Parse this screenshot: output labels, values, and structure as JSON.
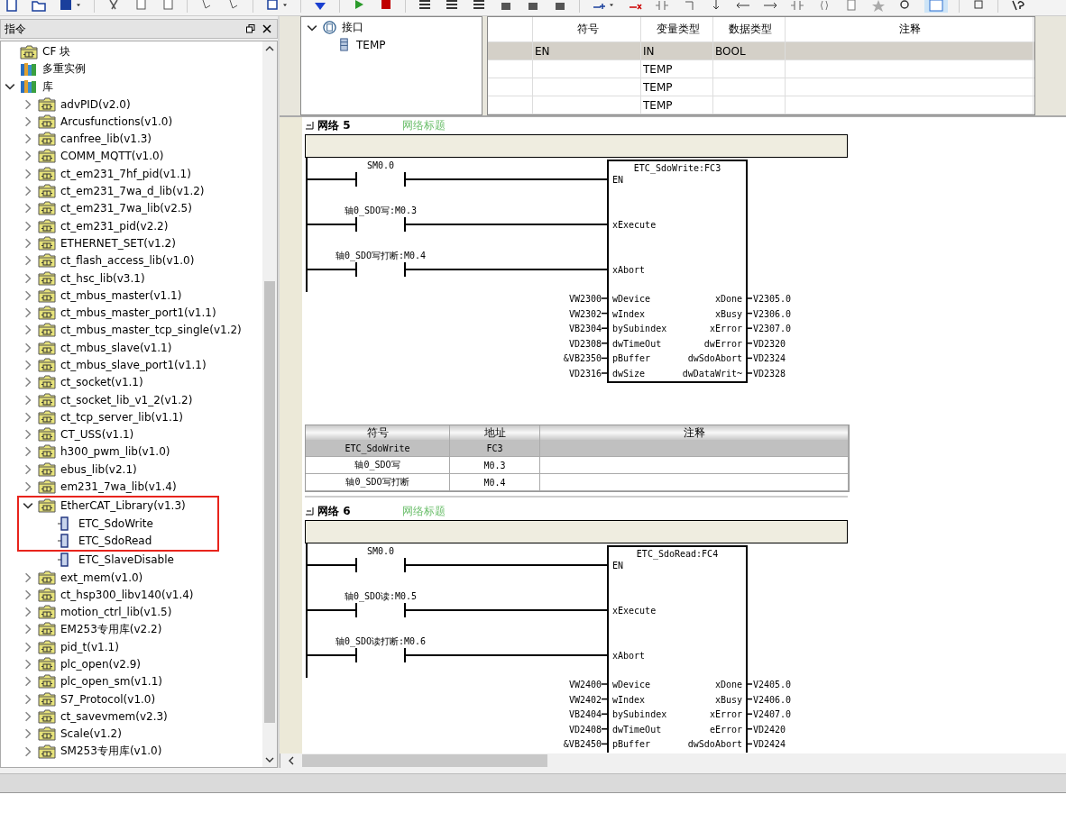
{
  "instructions": {
    "title": "指令",
    "tree": [
      {
        "label": "CF 块",
        "kind": "block-folder",
        "highlighted": false
      },
      {
        "label": "多重实例",
        "kind": "books",
        "highlighted": false
      },
      {
        "label": "库",
        "kind": "books",
        "expanded": true,
        "highlighted": false,
        "children": [
          {
            "label": "advPID(v2.0)",
            "kind": "block-folder",
            "expanded": false,
            "highlighted": false
          },
          {
            "label": "Arcusfunctions(v1.0)",
            "kind": "block-folder",
            "expanded": false,
            "highlighted": false
          },
          {
            "label": "canfree_lib(v1.3)",
            "kind": "block-folder",
            "expanded": false,
            "highlighted": false
          },
          {
            "label": "COMM_MQTT(v1.0)",
            "kind": "block-folder",
            "expanded": false,
            "highlighted": false
          },
          {
            "label": "ct_em231_7hf_pid(v1.1)",
            "kind": "block-folder",
            "expanded": false,
            "highlighted": false
          },
          {
            "label": "ct_em231_7wa_d_lib(v1.2)",
            "kind": "block-folder",
            "expanded": false,
            "highlighted": false
          },
          {
            "label": "ct_em231_7wa_lib(v2.5)",
            "kind": "block-folder",
            "expanded": false,
            "highlighted": false
          },
          {
            "label": "ct_em231_pid(v2.2)",
            "kind": "block-folder",
            "expanded": false,
            "highlighted": false
          },
          {
            "label": "ETHERNET_SET(v1.2)",
            "kind": "block-folder",
            "expanded": false,
            "highlighted": false
          },
          {
            "label": "ct_flash_access_lib(v1.0)",
            "kind": "block-folder",
            "expanded": false,
            "highlighted": false
          },
          {
            "label": "ct_hsc_lib(v3.1)",
            "kind": "block-folder",
            "expanded": false,
            "highlighted": false
          },
          {
            "label": "ct_mbus_master(v1.1)",
            "kind": "block-folder",
            "expanded": false,
            "highlighted": false
          },
          {
            "label": "ct_mbus_master_port1(v1.1)",
            "kind": "block-folder",
            "expanded": false,
            "highlighted": false
          },
          {
            "label": "ct_mbus_master_tcp_single(v1.2)",
            "kind": "block-folder",
            "expanded": false,
            "highlighted": false
          },
          {
            "label": "ct_mbus_slave(v1.1)",
            "kind": "block-folder",
            "expanded": false,
            "highlighted": false
          },
          {
            "label": "ct_mbus_slave_port1(v1.1)",
            "kind": "block-folder",
            "expanded": false,
            "highlighted": false
          },
          {
            "label": "ct_socket(v1.1)",
            "kind": "block-folder",
            "expanded": false,
            "highlighted": false
          },
          {
            "label": "ct_socket_lib_v1_2(v1.2)",
            "kind": "block-folder",
            "expanded": false,
            "highlighted": false
          },
          {
            "label": "ct_tcp_server_lib(v1.1)",
            "kind": "block-folder",
            "expanded": false,
            "highlighted": false
          },
          {
            "label": "CT_USS(v1.1)",
            "kind": "block-folder",
            "expanded": false,
            "highlighted": false
          },
          {
            "label": "h300_pwm_lib(v1.0)",
            "kind": "block-folder",
            "expanded": false,
            "highlighted": false
          },
          {
            "label": "ebus_lib(v2.1)",
            "kind": "block-folder",
            "expanded": false,
            "highlighted": false
          },
          {
            "label": "em231_7wa_lib(v1.4)",
            "kind": "block-folder",
            "expanded": false,
            "highlighted": false
          },
          {
            "label": "EtherCAT_Library(v1.3)",
            "kind": "block-folder",
            "expanded": true,
            "highlighted": true,
            "children": [
              {
                "label": "ETC_SdoWrite",
                "kind": "function",
                "highlighted": true
              },
              {
                "label": "ETC_SdoRead",
                "kind": "function",
                "highlighted": true
              },
              {
                "label": "ETC_SlaveDisable",
                "kind": "function",
                "highlighted": false
              }
            ]
          },
          {
            "label": "ext_mem(v1.0)",
            "kind": "block-folder",
            "expanded": false,
            "highlighted": false
          },
          {
            "label": "ct_hsp300_libv140(v1.4)",
            "kind": "block-folder",
            "expanded": false,
            "highlighted": false
          },
          {
            "label": "motion_ctrl_lib(v1.5)",
            "kind": "block-folder",
            "expanded": false,
            "highlighted": false
          },
          {
            "label": "EM253专用库(v2.2)",
            "kind": "block-folder",
            "expanded": false,
            "highlighted": false
          },
          {
            "label": "pid_t(v1.1)",
            "kind": "block-folder",
            "expanded": false,
            "highlighted": false
          },
          {
            "label": "plc_open(v2.9)",
            "kind": "block-folder",
            "expanded": false,
            "highlighted": false
          },
          {
            "label": "plc_open_sm(v1.1)",
            "kind": "block-folder",
            "expanded": false,
            "highlighted": false
          },
          {
            "label": "S7_Protocol(v1.0)",
            "kind": "block-folder",
            "expanded": false,
            "highlighted": false
          },
          {
            "label": "ct_savevmem(v2.3)",
            "kind": "block-folder",
            "expanded": false,
            "highlighted": false
          },
          {
            "label": "Scale(v1.2)",
            "kind": "block-folder",
            "expanded": false,
            "highlighted": false
          },
          {
            "label": "SM253专用库(v1.0)",
            "kind": "block-folder",
            "expanded": false,
            "highlighted": false
          }
        ]
      }
    ]
  },
  "interface": {
    "label": "接口",
    "expanded": true,
    "children": [
      "TEMP"
    ]
  },
  "variable_table": {
    "columns": [
      "符号",
      "变量类型",
      "数据类型",
      "注释"
    ],
    "rows": [
      {
        "cells": [
          "EN",
          "IN",
          "BOOL",
          ""
        ],
        "selected": true
      },
      {
        "cells": [
          "",
          "TEMP",
          "",
          ""
        ],
        "selected": false
      },
      {
        "cells": [
          "",
          "TEMP",
          "",
          ""
        ],
        "selected": false
      },
      {
        "cells": [
          "",
          "TEMP",
          "",
          ""
        ],
        "selected": false
      }
    ]
  },
  "networks": [
    {
      "title": "网络 5",
      "comment": "网络标题",
      "contacts": [
        "SM0.0",
        "轴0_SDO写:M0.3",
        "轴0_SDO写打断:M0.4"
      ],
      "block": {
        "title": "ETC_SdoWrite:FC3",
        "bool_inputs": [
          "EN",
          "xExecute",
          "xAbort"
        ],
        "params": [
          {
            "in_value": "VW2300",
            "in": "wDevice",
            "out": "xDone",
            "out_value": "V2305.0"
          },
          {
            "in_value": "VW2302",
            "in": "wIndex",
            "out": "xBusy",
            "out_value": "V2306.0"
          },
          {
            "in_value": "VB2304",
            "in": "bySubindex",
            "out": "xError",
            "out_value": "V2307.0"
          },
          {
            "in_value": "VD2308",
            "in": "dwTimeOut",
            "out": "dwError",
            "out_value": "VD2320"
          },
          {
            "in_value": "&VB2350",
            "in": "pBuffer",
            "out": "dwSdoAbort",
            "out_value": "VD2324"
          },
          {
            "in_value": "VD2316",
            "in": "dwSize",
            "out": "dwDataWrit~",
            "out_value": "VD2328"
          }
        ]
      },
      "symbols": {
        "columns": [
          "符号",
          "地址",
          "注释"
        ],
        "rows": [
          {
            "cells": [
              "ETC_SdoWrite",
              "FC3",
              ""
            ],
            "selected": true
          },
          {
            "cells": [
              "轴0_SDO写",
              "M0.3",
              ""
            ],
            "selected": false
          },
          {
            "cells": [
              "轴0_SDO写打断",
              "M0.4",
              ""
            ],
            "selected": false
          }
        ]
      }
    },
    {
      "title": "网络 6",
      "comment": "网络标题",
      "contacts": [
        "SM0.0",
        "轴0_SDO读:M0.5",
        "轴0_SDO读打断:M0.6"
      ],
      "block": {
        "title": "ETC_SdoRead:FC4",
        "bool_inputs": [
          "EN",
          "xExecute",
          "xAbort"
        ],
        "params": [
          {
            "in_value": "VW2400",
            "in": "wDevice",
            "out": "xDone",
            "out_value": "V2405.0"
          },
          {
            "in_value": "VW2402",
            "in": "wIndex",
            "out": "xBusy",
            "out_value": "V2406.0"
          },
          {
            "in_value": "VB2404",
            "in": "bySubindex",
            "out": "xError",
            "out_value": "V2407.0"
          },
          {
            "in_value": "VD2408",
            "in": "dwTimeOut",
            "out": "eError",
            "out_value": "VD2420"
          },
          {
            "in_value": "&VB2450",
            "in": "pBuffer",
            "out": "dwSdoAbort",
            "out_value": "VD2424"
          }
        ]
      }
    }
  ]
}
